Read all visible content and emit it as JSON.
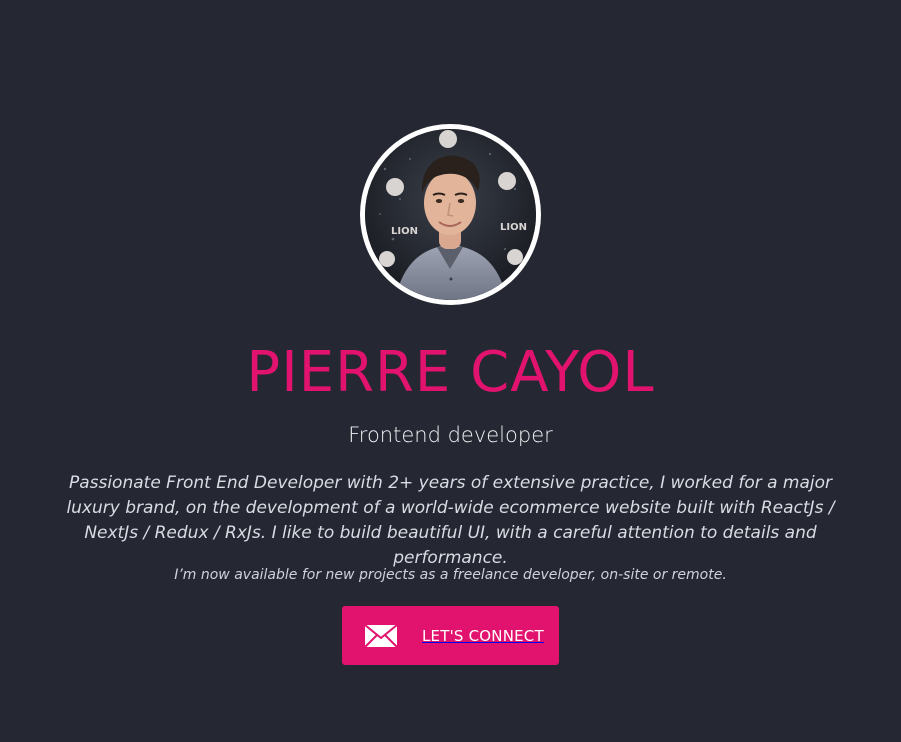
{
  "profile": {
    "name": "PIERRE CAYOL",
    "role": "Frontend developer",
    "bio": "Passionate Front End Developer with 2+ years of extensive practice, I worked for a major luxury brand, on the development of a world-wide ecommerce website built with ReactJs / NextJs / Redux / RxJs. I like to build beautiful UI, with a careful attention to details and performance.",
    "availability": "I’m now available for new projects as a freelance developer, on-site or remote.",
    "photo_backdrop_text_left": "LION",
    "photo_backdrop_text_right": "LION"
  },
  "cta": {
    "label": "LET'S CONNECT",
    "icon": "envelope-icon"
  },
  "colors": {
    "background": "#252833",
    "accent": "#e2136e",
    "text": "#e6e8ee"
  }
}
